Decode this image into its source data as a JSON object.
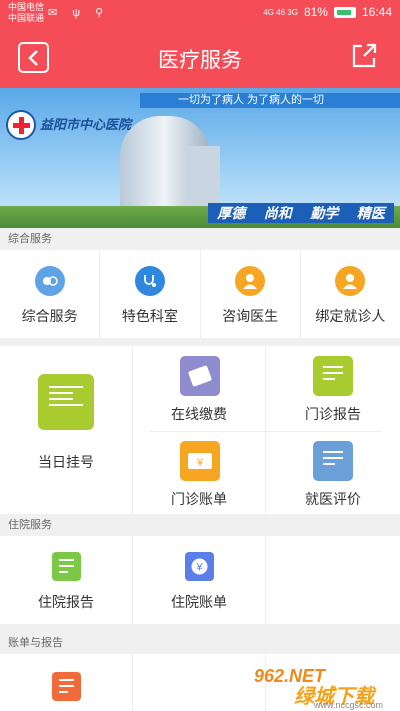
{
  "status_bar": {
    "carrier1": "中国电信",
    "carrier2": "中国联通",
    "left_icons": "✉ ψ ⚲",
    "network": "4G 46 3G",
    "battery_pct": "81%",
    "time": "16:44"
  },
  "nav": {
    "title": "医疗服务",
    "back_icon": "back-icon",
    "share_icon": "share-icon"
  },
  "banner": {
    "slogan": "一切为了病人 为了病人的一切",
    "hospital_name": "益阳市中心医院",
    "motto": [
      "厚德",
      "尚和",
      "勤学",
      "精医"
    ]
  },
  "sections": {
    "general": {
      "header": "综合服务",
      "items": [
        {
          "label": "综合服务",
          "icon": "people-icon",
          "color": "#5fa3e6"
        },
        {
          "label": "特色科室",
          "icon": "stethoscope-icon",
          "color": "#2f87e0"
        },
        {
          "label": "咨询医生",
          "icon": "doctor-icon",
          "color": "#f6a623"
        },
        {
          "label": "绑定就诊人",
          "icon": "patient-icon",
          "color": "#f6a623"
        }
      ]
    },
    "outpatient": {
      "big_item": {
        "label": "当日挂号",
        "icon": "register-icon",
        "color": "#a8cc2f"
      },
      "items": [
        {
          "label": "在线缴费",
          "icon": "payment-icon",
          "color": "#8e8ccf"
        },
        {
          "label": "门诊报告",
          "icon": "report-icon",
          "color": "#a8cc2f"
        },
        {
          "label": "门诊账单",
          "icon": "bill-icon",
          "color": "#f6a623"
        },
        {
          "label": "就医评价",
          "icon": "evaluate-icon",
          "color": "#6a9fd8"
        }
      ]
    },
    "inpatient": {
      "header": "住院服务",
      "items": [
        {
          "label": "住院报告",
          "icon": "report-icon",
          "color": "#7bc846"
        },
        {
          "label": "住院账单",
          "icon": "yen-icon",
          "color": "#5b7fe8"
        }
      ]
    },
    "billing": {
      "header": "账单与报告",
      "items": [
        {
          "label": "",
          "icon": "list-icon",
          "color": "#f06a3c"
        }
      ]
    }
  },
  "watermark": {
    "text": "绿城下载",
    "sub": "www.nccgsc.com",
    "brand": "962.NET"
  }
}
